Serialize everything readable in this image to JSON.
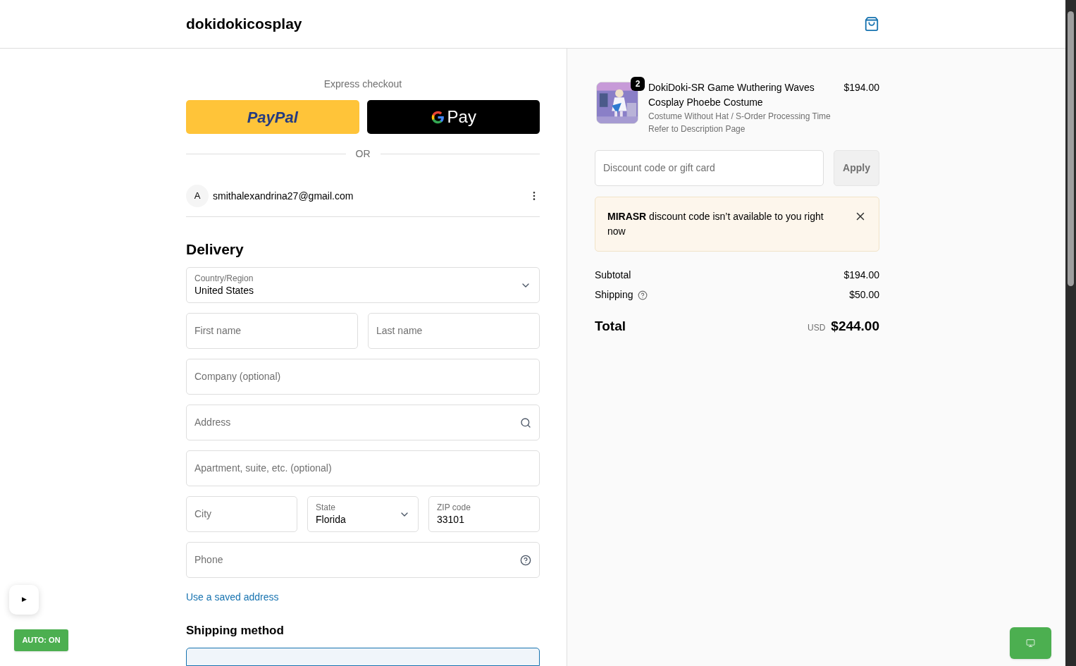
{
  "header": {
    "store_name": "dokidokicosplay"
  },
  "express_checkout": {
    "label": "Express checkout",
    "buttons": [
      {
        "kind": "paypal",
        "label": "PayPal"
      },
      {
        "kind": "gpay",
        "label": "Pay"
      }
    ],
    "divider_label": "OR"
  },
  "account": {
    "avatar": "A",
    "email": "smithalexandrina27@gmail.com"
  },
  "delivery": {
    "title": "Delivery",
    "rows": [
      [
        {
          "kind": "select",
          "label": "Country/Region",
          "value": "United States"
        }
      ],
      [
        {
          "kind": "text",
          "placeholder": "First name"
        },
        {
          "kind": "text",
          "placeholder": "Last name"
        }
      ],
      [
        {
          "kind": "text",
          "placeholder": "Company (optional)"
        }
      ],
      [
        {
          "kind": "search",
          "placeholder": "Address"
        }
      ],
      [
        {
          "kind": "text",
          "placeholder": "Apartment, suite, etc. (optional)"
        }
      ],
      [
        {
          "kind": "text",
          "placeholder": "City"
        },
        {
          "kind": "select",
          "label": "State",
          "value": "Florida"
        },
        {
          "kind": "text",
          "label": "ZIP code",
          "value": "33101"
        }
      ],
      [
        {
          "kind": "help",
          "placeholder": "Phone"
        }
      ]
    ],
    "saved_address_link": "Use a saved address"
  },
  "shipping_method": {
    "title": "Shipping method",
    "options": [
      {
        "selected": true
      }
    ]
  },
  "order_summary": {
    "items": [
      {
        "quantity": "2",
        "name": "DokiDoki-SR Game Wuthering Waves Cosplay Phoebe Costume",
        "variant": "Costume Without Hat / S-Order Processing Time",
        "note": "Refer to Description Page",
        "price": "$194.00"
      }
    ],
    "discount": {
      "placeholder": "Discount code or gift card",
      "button": "Apply"
    },
    "alert": {
      "text": "**MIRASR** discount code isn’t available to you right now"
    },
    "lines": [
      {
        "label": "Subtotal",
        "value": "$194.00",
        "help": false
      },
      {
        "label": "Shipping",
        "value": "$50.00",
        "help": true
      }
    ],
    "total": {
      "label": "Total",
      "currency": "USD",
      "value": "$244.00"
    }
  },
  "overlay": {
    "play_button": "▶",
    "auto_button": "AUTO: ON"
  }
}
